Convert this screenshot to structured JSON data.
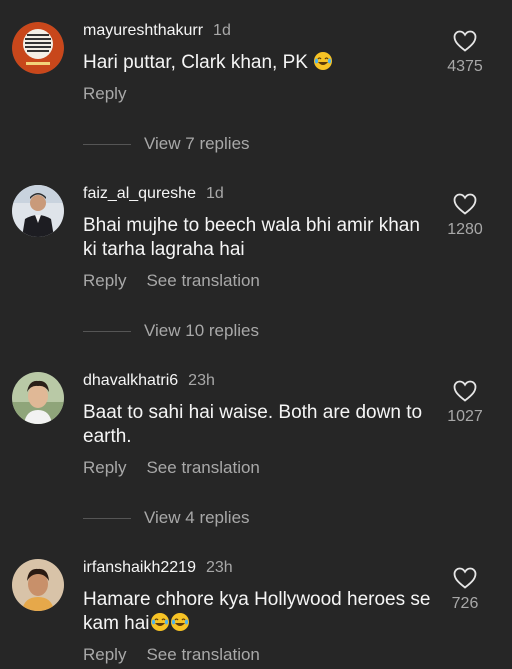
{
  "comments": [
    {
      "username": "mayureshthakurr",
      "time": "1d",
      "text": "Hari puttar, Clark khan, PK",
      "emoji_count": 1,
      "likes": "4375",
      "reply_label": "Reply",
      "translate_label": "",
      "view_replies": "View 7 replies"
    },
    {
      "username": "faiz_al_qureshe",
      "time": "1d",
      "text": "Bhai mujhe to beech wala bhi amir khan ki tarha lagraha hai",
      "emoji_count": 0,
      "likes": "1280",
      "reply_label": "Reply",
      "translate_label": "See translation",
      "view_replies": "View 10 replies"
    },
    {
      "username": "dhavalkhatri6",
      "time": "23h",
      "text": "Baat to sahi hai waise. Both are down to earth.",
      "emoji_count": 0,
      "likes": "1027",
      "reply_label": "Reply",
      "translate_label": "See translation",
      "view_replies": "View 4 replies"
    },
    {
      "username": "irfanshaikh2219",
      "time": "23h",
      "text": "Hamare chhore kya Hollywood heroes se kam hai",
      "emoji_count": 2,
      "likes": "726",
      "reply_label": "Reply",
      "translate_label": "See translation",
      "view_replies": ""
    }
  ],
  "icons": {
    "like": "heart-outline-icon",
    "emoji": "laughing-tears-emoji"
  },
  "colors": {
    "background": "#262626",
    "primary_text": "#f5f5f5",
    "secondary_text": "#a8a8a8",
    "avatar1_bg": "#c8471b",
    "emoji_yellow": "#f7c325"
  }
}
